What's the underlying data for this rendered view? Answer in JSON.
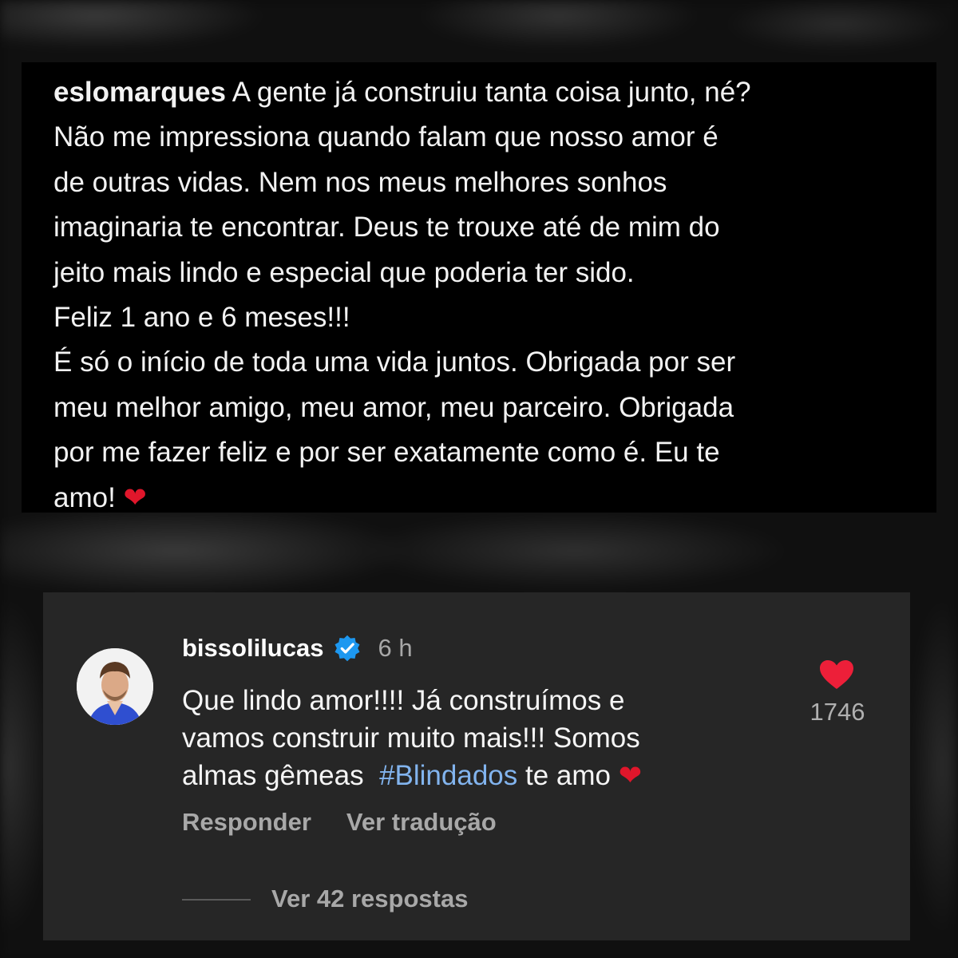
{
  "caption": {
    "username": "eslomarques",
    "text": " A gente já construiu tanta coisa junto, né?\nNão me impressiona quando falam que nosso amor é\nde outras vidas. Nem nos meus melhores sonhos\nimaginaria te encontrar. Deus te trouxe até de mim do\njeito mais lindo e especial que poderia ter sido.\nFeliz 1 ano e 6 meses!!!\nÉ só o início de toda uma vida juntos. Obrigada por ser\nmeu melhor amigo, meu amor, meu parceiro. Obrigada\npor me fazer feliz e por ser exatamente como é. Eu te\namo! ",
    "emoji": "❤"
  },
  "comment": {
    "username": "bissolilucas",
    "time": "6 h",
    "text_part1": "Que lindo amor!!!! Já construímos e\nvamos construir muito mais!!! Somos\nalmas gêmeas  ",
    "hashtag": "#Blindados",
    "text_part2": " te amo ",
    "emoji": "❤",
    "likes": "1746",
    "reply_label": "Responder",
    "translate_label": "Ver tradução",
    "view_replies_label": "Ver 42 respostas",
    "icons": {
      "verified": "verified-badge-icon",
      "like": "heart-icon"
    },
    "colors": {
      "panel": "#262626",
      "hashtag": "#82b4ee",
      "heart": "#ed1f39",
      "verified": "#1d98f0"
    }
  }
}
